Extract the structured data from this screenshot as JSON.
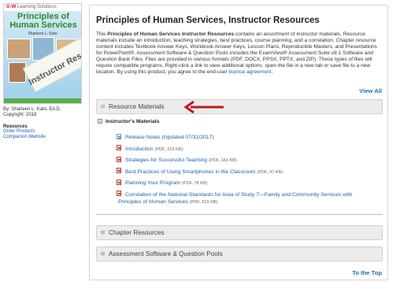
{
  "cover": {
    "publisher": "G-W",
    "publisher_suffix": "Learning Solutions",
    "title": "Principles of Human Services",
    "author_line": "Sharleen L. Kato",
    "banner": "Instructor Resources"
  },
  "book_info": {
    "author": "By: Sharleen L. Kato, Ed.D.",
    "copyright": "Copyright: 2018"
  },
  "sidebar": {
    "heading": "Resources",
    "links": [
      "Order Products",
      "Companion Website"
    ]
  },
  "main": {
    "title": "Principles of Human Services, Instructor Resources",
    "desc_intro": "This ",
    "desc_bold": "Principles of Human Services Instructor Resources",
    "desc_body": " contains an assortment of instructor materials. Resource materials include an introduction, teaching strategies, best practices, course planning, and a correlation. Chapter resource content includes Textbook Answer Keys, Workbook Answer Keys, Lesson Plans, Reproducible Masters, and Presentations for PowerPoint®. Assessment Software & Question Pools includes the ExamView® Assessment Suite v9.1 Software and Question Bank Files. Files are provided in various formats (PDF, DOCX, PPSX, PPTX, and ZIP). These types of files will require compatible programs. Right-click a link to view additional options: open the file in a new tab or save file to a new location. By using this product, you agree to the end-user ",
    "desc_link": "license agreement",
    "desc_end": ".",
    "view_all": "View All",
    "sections": [
      {
        "label": "Resource Materials",
        "icon": "⊟"
      },
      {
        "label": "Chapter Resources",
        "icon": "⊞"
      },
      {
        "label": "Assessment Software & Question Pools",
        "icon": "⊞"
      }
    ],
    "subsection": "Instructor's Materials",
    "files": [
      {
        "title": "Release Notes (Updated 07/31/2017)",
        "meta": "",
        "type": "doc"
      },
      {
        "title": "Introduction",
        "meta": "(PDF, 219 KB)",
        "type": "pdf"
      },
      {
        "title": "Strategies for Successful Teaching",
        "meta": "(PDF, 163 KB)",
        "type": "pdf"
      },
      {
        "title": "Best Practices of Using Smartphones in the Classroom",
        "meta": "(PDF, 47 KB)",
        "type": "pdf"
      },
      {
        "title": "Planning Your Program",
        "meta": "(PDF, 78 KB)",
        "type": "pdf"
      },
      {
        "title": "Correlation of the National Standards for Area of Study 7—Family and Community Services with",
        "meta": "",
        "type": "pdf"
      }
    ],
    "file_wrap": {
      "title": "Principles of Human Services",
      "meta": "(PDF, 519 KB)"
    },
    "to_top": "To the Top"
  },
  "colors": {
    "link": "#1a5fa8",
    "arrow": "#b81c1c",
    "accordion_bg": "#ececec"
  }
}
